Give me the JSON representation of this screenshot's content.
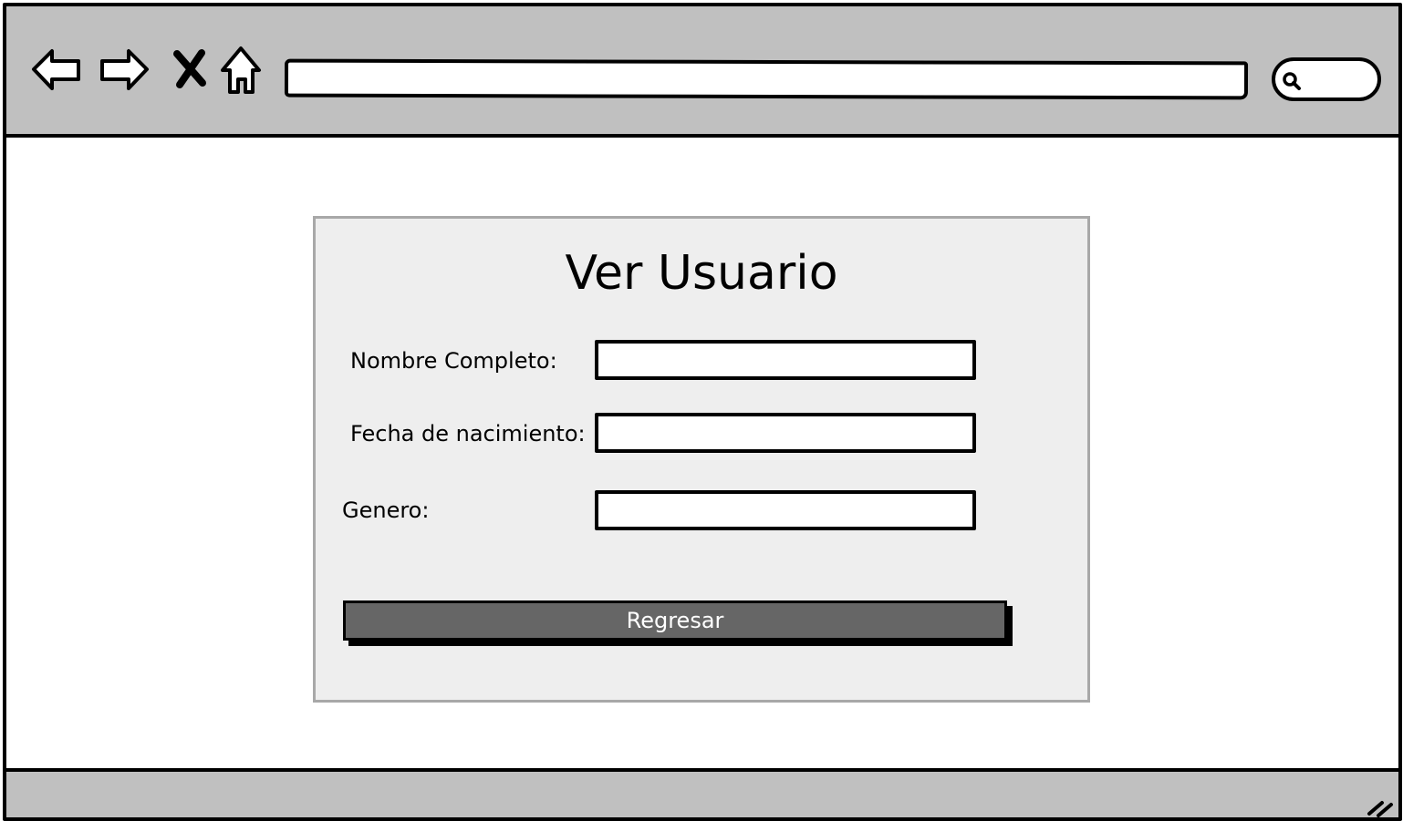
{
  "browser": {
    "back_icon": "arrow-left-icon",
    "forward_icon": "arrow-right-icon",
    "stop_icon": "close-icon",
    "home_icon": "home-icon",
    "url": "",
    "search_icon": "search-icon",
    "search_value": ""
  },
  "form": {
    "title": "Ver Usuario",
    "fields": [
      {
        "label": "Nombre Completo:",
        "value": ""
      },
      {
        "label": "Fecha de nacimiento:",
        "value": ""
      },
      {
        "label": "Genero:",
        "value": ""
      }
    ],
    "back_button_label": "Regresar"
  },
  "colors": {
    "chrome": "#c0c0c0",
    "panel": "#eeeeee",
    "panel_border": "#a8a8a8",
    "button": "#666666",
    "button_text": "#ffffff"
  }
}
